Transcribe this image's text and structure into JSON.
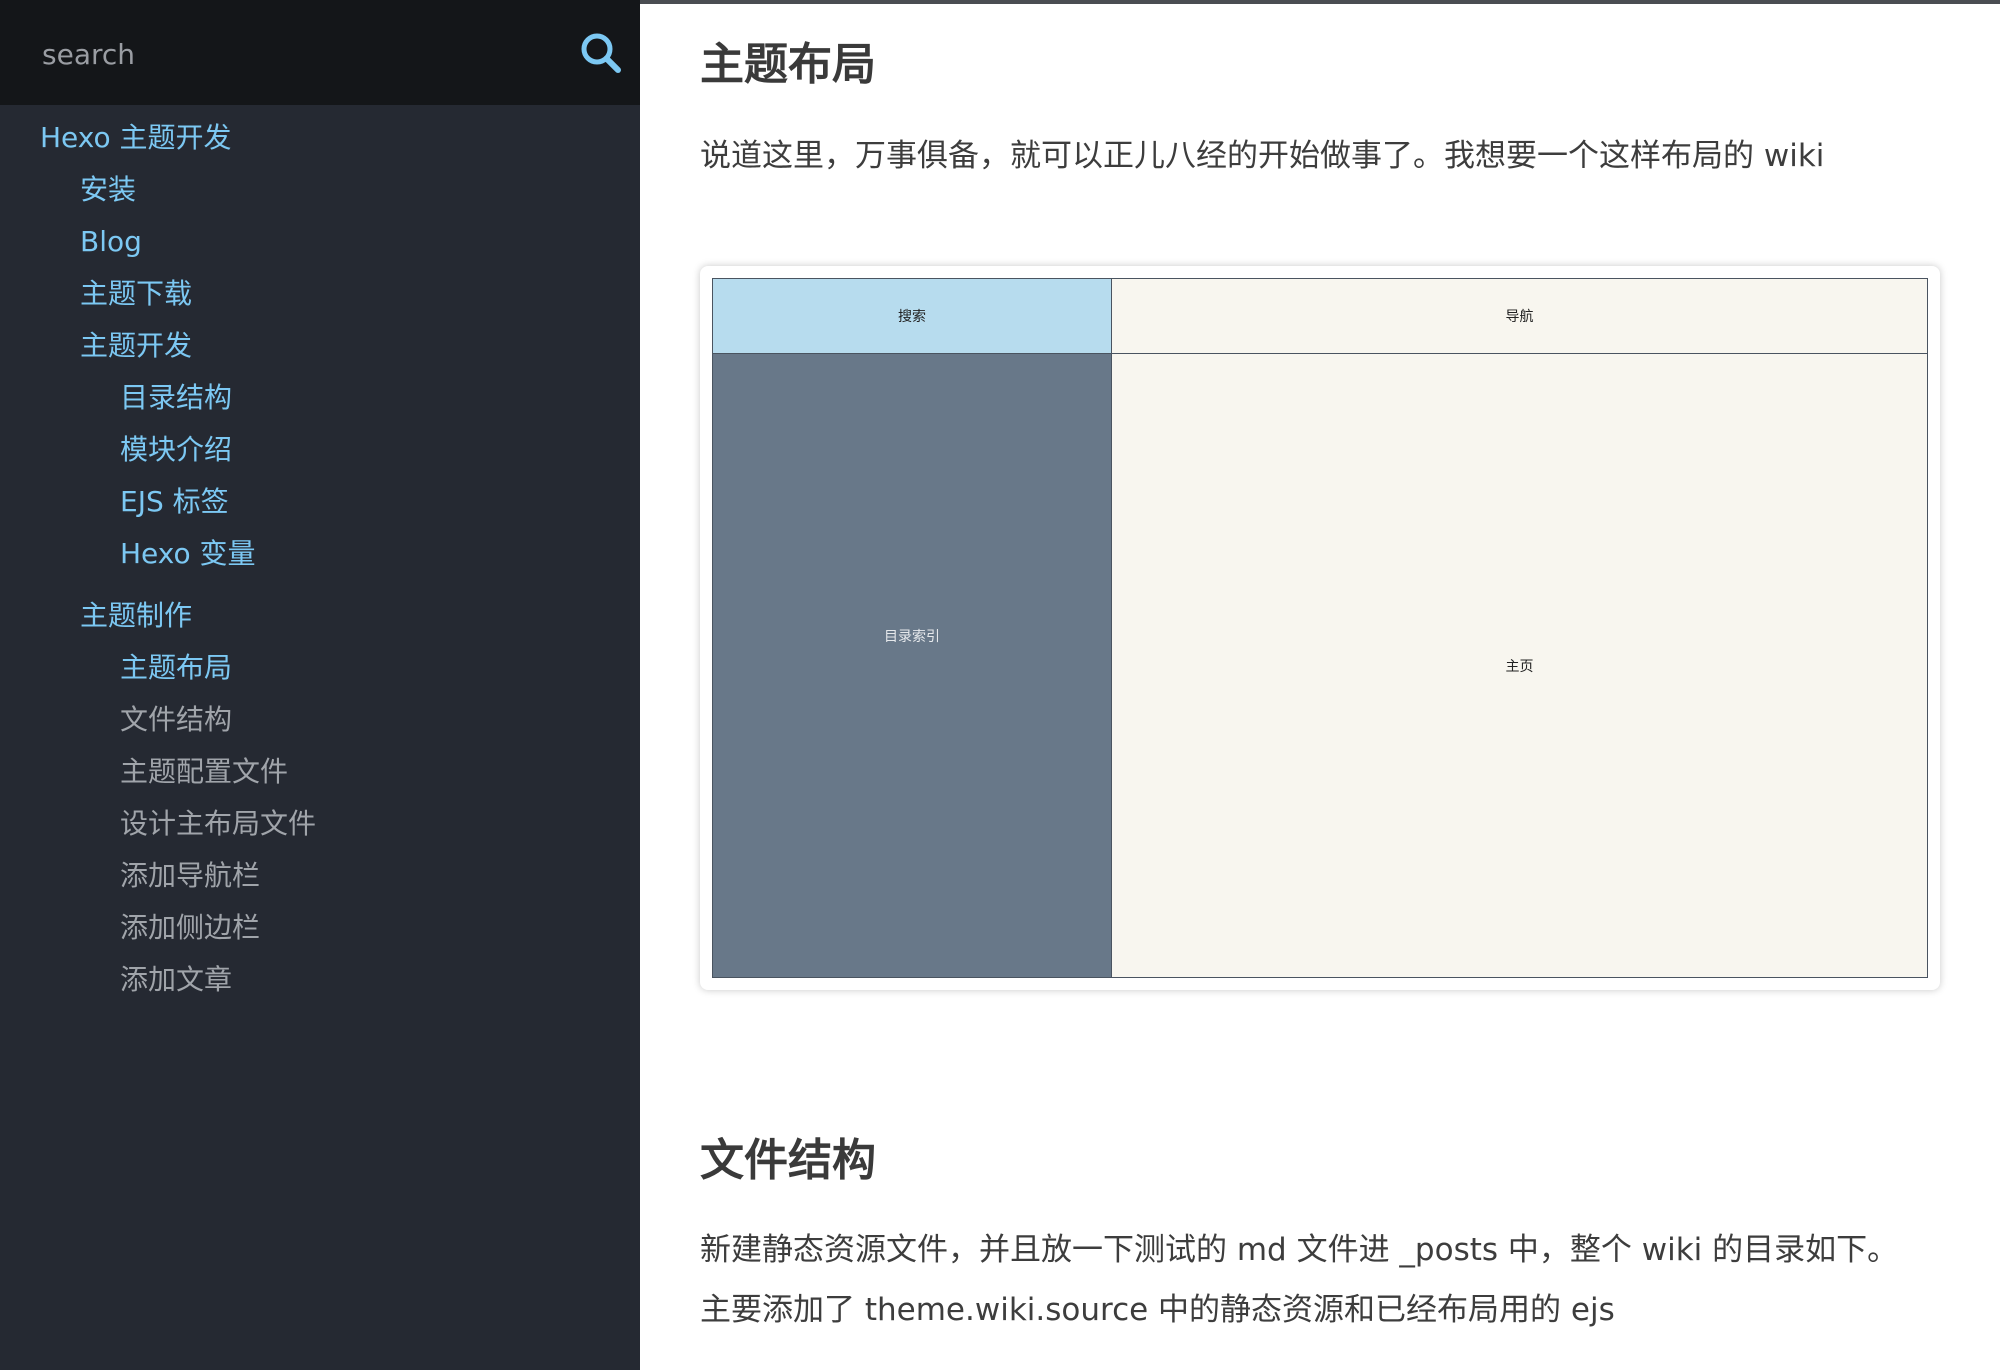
{
  "search": {
    "placeholder": "search"
  },
  "sidebar": {
    "items": [
      {
        "label": "Hexo 主题开发",
        "state": "link"
      },
      {
        "label": "安装",
        "state": "link"
      },
      {
        "label": "Blog",
        "state": "link"
      },
      {
        "label": "主题下载",
        "state": "link"
      },
      {
        "label": "主题开发",
        "state": "link"
      },
      {
        "label": "目录结构",
        "state": "link"
      },
      {
        "label": "模块介绍",
        "state": "link"
      },
      {
        "label": "EJS 标签",
        "state": "link"
      },
      {
        "label": "Hexo 变量",
        "state": "link"
      },
      {
        "label": "主题制作",
        "state": "link"
      },
      {
        "label": "主题布局",
        "state": "link"
      },
      {
        "label": "文件结构",
        "state": "muted"
      },
      {
        "label": "主题配置文件",
        "state": "muted"
      },
      {
        "label": "设计主布局文件",
        "state": "muted"
      },
      {
        "label": "添加导航栏",
        "state": "muted"
      },
      {
        "label": "添加侧边栏",
        "state": "muted"
      },
      {
        "label": "添加文章",
        "state": "muted"
      }
    ]
  },
  "main": {
    "section1": {
      "heading": "主题布局",
      "paragraph": "说道这里，万事俱备，就可以正儿八经的开始做事了。我想要一个这样布局的 wiki"
    },
    "diagram": {
      "search": "搜索",
      "nav": "导航",
      "index": "目录索引",
      "main": "主页"
    },
    "section2": {
      "heading": "文件结构",
      "line1": "新建静态资源文件，并且放一下测试的 md 文件进 _posts 中，整个 wiki 的目录如下。",
      "line2": "主要添加了 theme.wiki.source 中的静态资源和已经布局用的 ejs"
    }
  },
  "colors": {
    "sidebar_bg": "#252932",
    "search_bg": "#141619",
    "link": "#7cc8f3",
    "muted": "#a0a4aa",
    "diagram_search": "#b7dcee",
    "diagram_index": "#687889",
    "diagram_main": "#f8f6ef"
  }
}
